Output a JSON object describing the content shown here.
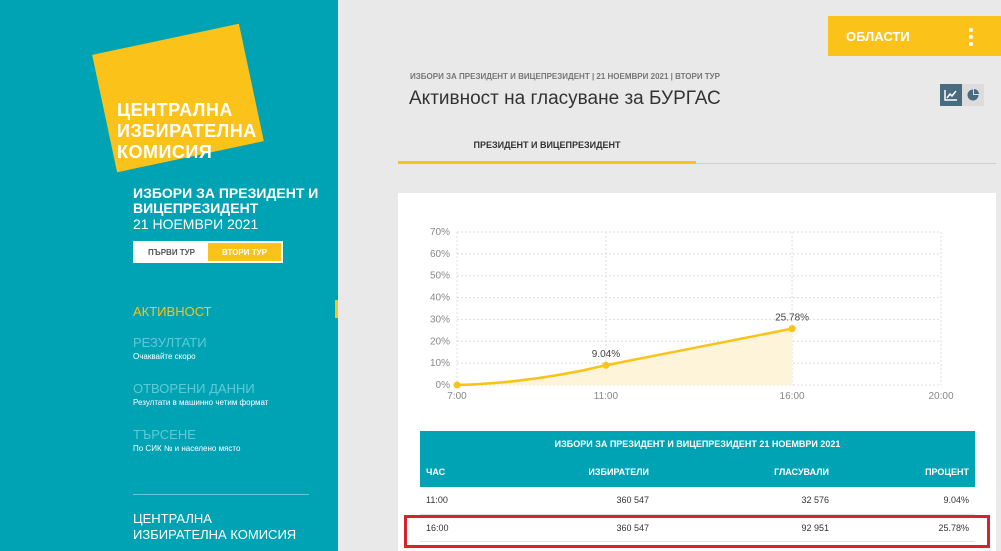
{
  "sidebar": {
    "logo_lines": [
      "ЦЕНТРАЛНА",
      "ИЗБИРАТЕЛНА",
      "КОМИСИЯ"
    ],
    "election_title": "ИЗБОРИ ЗА ПРЕЗИДЕНТ И ВИЦЕПРЕЗИДЕНТ",
    "election_date": "21 НОЕМВРИ 2021",
    "round1": "ПЪРВИ ТУР",
    "round2": "ВТОРИ ТУР",
    "nav": [
      {
        "label": "АКТИВНОСТ",
        "sub": ""
      },
      {
        "label": "РЕЗУЛТАТИ",
        "sub": "Очаквайте скоро"
      },
      {
        "label": "ОТВОРЕНИ ДАННИ",
        "sub": "Резултати в машинно четим формат"
      },
      {
        "label": "ТЪРСЕНЕ",
        "sub": "По СИК № и населено място"
      }
    ],
    "footer": "ЦЕНТРАЛНА ИЗБИРАТЕЛНА КОМИСИЯ"
  },
  "header": {
    "areas_button": "ОБЛАСТИ",
    "breadcrumb": "ИЗБОРИ ЗА ПРЕЗИДЕНТ И ВИЦЕПРЕЗИДЕНТ | 21 НОЕМВРИ 2021 | ВТОРИ ТУР",
    "title": "Активност на гласуване за БУРГАС",
    "tab": "ПРЕЗИДЕНТ И ВИЦЕПРЕЗИДЕНТ"
  },
  "icons": {
    "chart": "line-chart-icon",
    "pie": "pie-chart-icon",
    "menu": "kebab-menu-icon"
  },
  "colors": {
    "teal": "#00a3b4",
    "yellow": "#fbc21a",
    "highlight": "#d8232a"
  },
  "chart_data": {
    "type": "line",
    "x": [
      "7:00",
      "11:00",
      "16:00"
    ],
    "x_ticks": [
      "7:00",
      "11:00",
      "16:00",
      "20:00"
    ],
    "y_ticks": [
      "0%",
      "10%",
      "20%",
      "30%",
      "40%",
      "50%",
      "60%",
      "70%"
    ],
    "ylim": [
      0,
      70
    ],
    "values": [
      0,
      9.04,
      25.78
    ],
    "labels": [
      "",
      "9.04%",
      "25.78%"
    ],
    "grid": true
  },
  "table": {
    "title": "ИЗБОРИ ЗА ПРЕЗИДЕНТ И ВИЦЕПРЕЗИДЕНТ 21 НОЕМВРИ 2021",
    "columns": [
      "ЧАС",
      "ИЗБИРАТЕЛИ",
      "ГЛАСУВАЛИ",
      "ПРОЦЕНТ"
    ],
    "rows": [
      [
        "11:00",
        "360 547",
        "32 576",
        "9.04%"
      ],
      [
        "16:00",
        "360 547",
        "92 951",
        "25.78%"
      ]
    ]
  }
}
